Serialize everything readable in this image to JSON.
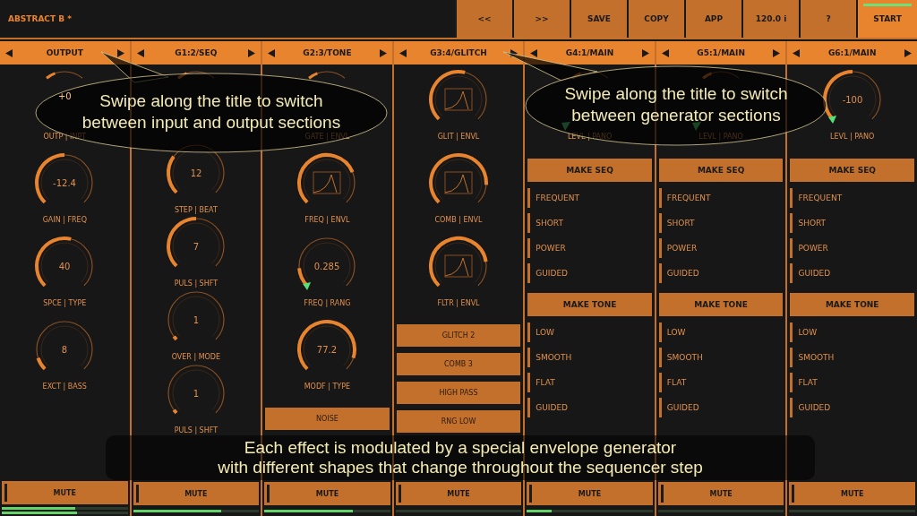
{
  "header": {
    "title": "ABSTRACT B *"
  },
  "toolbar": [
    {
      "label": "<<",
      "active": false
    },
    {
      "label": ">>",
      "active": false
    },
    {
      "label": "SAVE",
      "active": false
    },
    {
      "label": "COPY",
      "active": false
    },
    {
      "label": "APP",
      "active": false
    },
    {
      "label": "120.0 i",
      "active": false
    },
    {
      "label": "?",
      "active": false
    },
    {
      "label": "START",
      "active": true
    }
  ],
  "columns": [
    {
      "title": "OUTPUT",
      "knobs": [
        {
          "kind": "covered",
          "value": "+0",
          "label": "OUTP | INPT",
          "marker": false
        },
        {
          "kind": "value",
          "value": "-12.4",
          "label": "GAIN | FREQ",
          "marker": false
        },
        {
          "kind": "value",
          "value": "40",
          "label": "SPCE | TYPE",
          "marker": false
        },
        {
          "kind": "value",
          "value": "8",
          "label": "EXCT | BASS",
          "marker": false
        }
      ],
      "mute": "MUTE",
      "meters": [
        {
          "level": 0.58
        },
        {
          "level": 0.6
        }
      ]
    },
    {
      "title": "G1:2/SEQ",
      "knobs": [
        {
          "kind": "covered",
          "marker": false
        },
        {
          "kind": "value",
          "value": "12",
          "label": "STEP | BEAT",
          "marker": false
        },
        {
          "kind": "value",
          "value": "7",
          "label": "PULS | SHFT",
          "marker": false
        },
        {
          "kind": "value",
          "value": "1",
          "label": "OVER | MODE",
          "marker": false
        },
        {
          "kind": "value",
          "value": "1",
          "label": "PULS | SHFT",
          "marker": false
        }
      ],
      "mute": "MUTE",
      "meters": [
        {
          "level": 0.7
        }
      ]
    },
    {
      "title": "G2:3/TONE",
      "knobs": [
        {
          "kind": "covered",
          "label": "GATE | ENVL",
          "marker": false
        },
        {
          "kind": "envelope",
          "label": "FREQ | ENVL",
          "marker": false
        },
        {
          "kind": "value",
          "value": "0.285",
          "label": "FREQ | RANG",
          "marker": true
        },
        {
          "kind": "value",
          "value": "77.2",
          "label": "MODF | TYPE",
          "marker": false
        }
      ],
      "buttons": [
        "NOISE"
      ],
      "mute": "MUTE",
      "meters": [
        {
          "level": 0.7
        }
      ]
    },
    {
      "title": "G3:4/GLITCH",
      "knobs": [
        {
          "kind": "envelope",
          "label": "GLIT | ENVL",
          "marker": false
        },
        {
          "kind": "envelope",
          "label": "COMB | ENVL",
          "marker": false
        },
        {
          "kind": "envelope",
          "label": "FLTR | ENVL",
          "marker": false
        }
      ],
      "buttons": [
        "GLITCH 2",
        "COMB 3",
        "HIGH PASS",
        "RNG LOW"
      ],
      "mute": "MUTE",
      "meters": [
        {
          "level": 0
        }
      ]
    },
    {
      "title": "G4:1/MAIN",
      "knobs": [
        {
          "kind": "covered",
          "label": "LEVL | PANO",
          "marker": true
        }
      ],
      "sections": [
        {
          "heading": "MAKE SEQ",
          "items": [
            "FREQUENT",
            "SHORT",
            "POWER",
            "GUIDED"
          ]
        },
        {
          "heading": "MAKE TONE",
          "items": [
            "LOW",
            "SMOOTH",
            "FLAT",
            "GUIDED"
          ]
        }
      ],
      "mute": "MUTE",
      "meters": [
        {
          "level": 0.2
        }
      ]
    },
    {
      "title": "G5:1/MAIN",
      "knobs": [
        {
          "kind": "covered",
          "label": "LEVL | PANO",
          "marker": true
        }
      ],
      "sections": [
        {
          "heading": "MAKE SEQ",
          "items": [
            "FREQUENT",
            "SHORT",
            "POWER",
            "GUIDED"
          ]
        },
        {
          "heading": "MAKE TONE",
          "items": [
            "LOW",
            "SMOOTH",
            "FLAT",
            "GUIDED"
          ]
        }
      ],
      "mute": "MUTE",
      "meters": [
        {
          "level": 0
        }
      ]
    },
    {
      "title": "G6:1/MAIN",
      "knobs": [
        {
          "kind": "value",
          "value": "-100",
          "label": "LEVL | PANO",
          "marker": true
        }
      ],
      "sections": [
        {
          "heading": "MAKE SEQ",
          "items": [
            "FREQUENT",
            "SHORT",
            "POWER",
            "GUIDED"
          ]
        },
        {
          "heading": "MAKE TONE",
          "items": [
            "LOW",
            "SMOOTH",
            "FLAT",
            "GUIDED"
          ]
        }
      ],
      "mute": "MUTE",
      "meters": [
        {
          "level": 0
        }
      ]
    }
  ],
  "callouts": [
    {
      "lines": [
        "Swipe along the title to switch",
        "between input and output sections"
      ]
    },
    {
      "lines": [
        "Swipe along the title to switch",
        "between generator sections"
      ]
    }
  ],
  "caption": {
    "lines": [
      "Each effect is modulated by a special envelope generator",
      "with different shapes that change throughout the sequencer step"
    ]
  }
}
